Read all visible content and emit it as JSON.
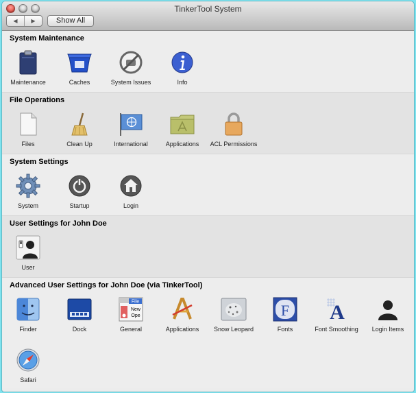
{
  "window": {
    "title": "TinkerTool System"
  },
  "toolbar": {
    "show_all_label": "Show All"
  },
  "sections": [
    {
      "title": "System Maintenance",
      "items": [
        {
          "label": "Maintenance",
          "icon": "clipboard-icon"
        },
        {
          "label": "Caches",
          "icon": "recycle-bin-icon"
        },
        {
          "label": "System Issues",
          "icon": "no-entry-icon"
        },
        {
          "label": "Info",
          "icon": "info-icon"
        }
      ]
    },
    {
      "title": "File Operations",
      "items": [
        {
          "label": "Files",
          "icon": "document-icon"
        },
        {
          "label": "Clean Up",
          "icon": "broom-icon"
        },
        {
          "label": "International",
          "icon": "un-flag-icon"
        },
        {
          "label": "Applications",
          "icon": "applications-folder-icon"
        },
        {
          "label": "ACL Permissions",
          "icon": "padlock-icon"
        }
      ]
    },
    {
      "title": "System Settings",
      "items": [
        {
          "label": "System",
          "icon": "gear-icon"
        },
        {
          "label": "Startup",
          "icon": "power-icon"
        },
        {
          "label": "Login",
          "icon": "home-icon"
        }
      ]
    },
    {
      "title": "User Settings for John Doe",
      "items": [
        {
          "label": "User",
          "icon": "user-switch-icon"
        }
      ]
    },
    {
      "title": "Advanced User Settings for John Doe (via TinkerTool)",
      "items": [
        {
          "label": "Finder",
          "icon": "finder-icon"
        },
        {
          "label": "Dock",
          "icon": "dock-icon"
        },
        {
          "label": "General",
          "icon": "general-icon",
          "icon_text": [
            "File",
            "New",
            "Ope"
          ]
        },
        {
          "label": "Applications",
          "icon": "applications-icon"
        },
        {
          "label": "Snow Leopard",
          "icon": "snow-leopard-icon"
        },
        {
          "label": "Fonts",
          "icon": "fonts-icon",
          "icon_text": [
            "F"
          ]
        },
        {
          "label": "Font Smoothing",
          "icon": "font-smoothing-icon",
          "icon_text": [
            "A"
          ]
        },
        {
          "label": "Login Items",
          "icon": "login-items-icon"
        },
        {
          "label": "Safari",
          "icon": "safari-icon"
        }
      ]
    }
  ],
  "colors": {
    "accent_info": "#3b5fd1",
    "close_button": "#d8342a",
    "folder": "#b9bf6a",
    "dock": "#1d4aa6"
  }
}
